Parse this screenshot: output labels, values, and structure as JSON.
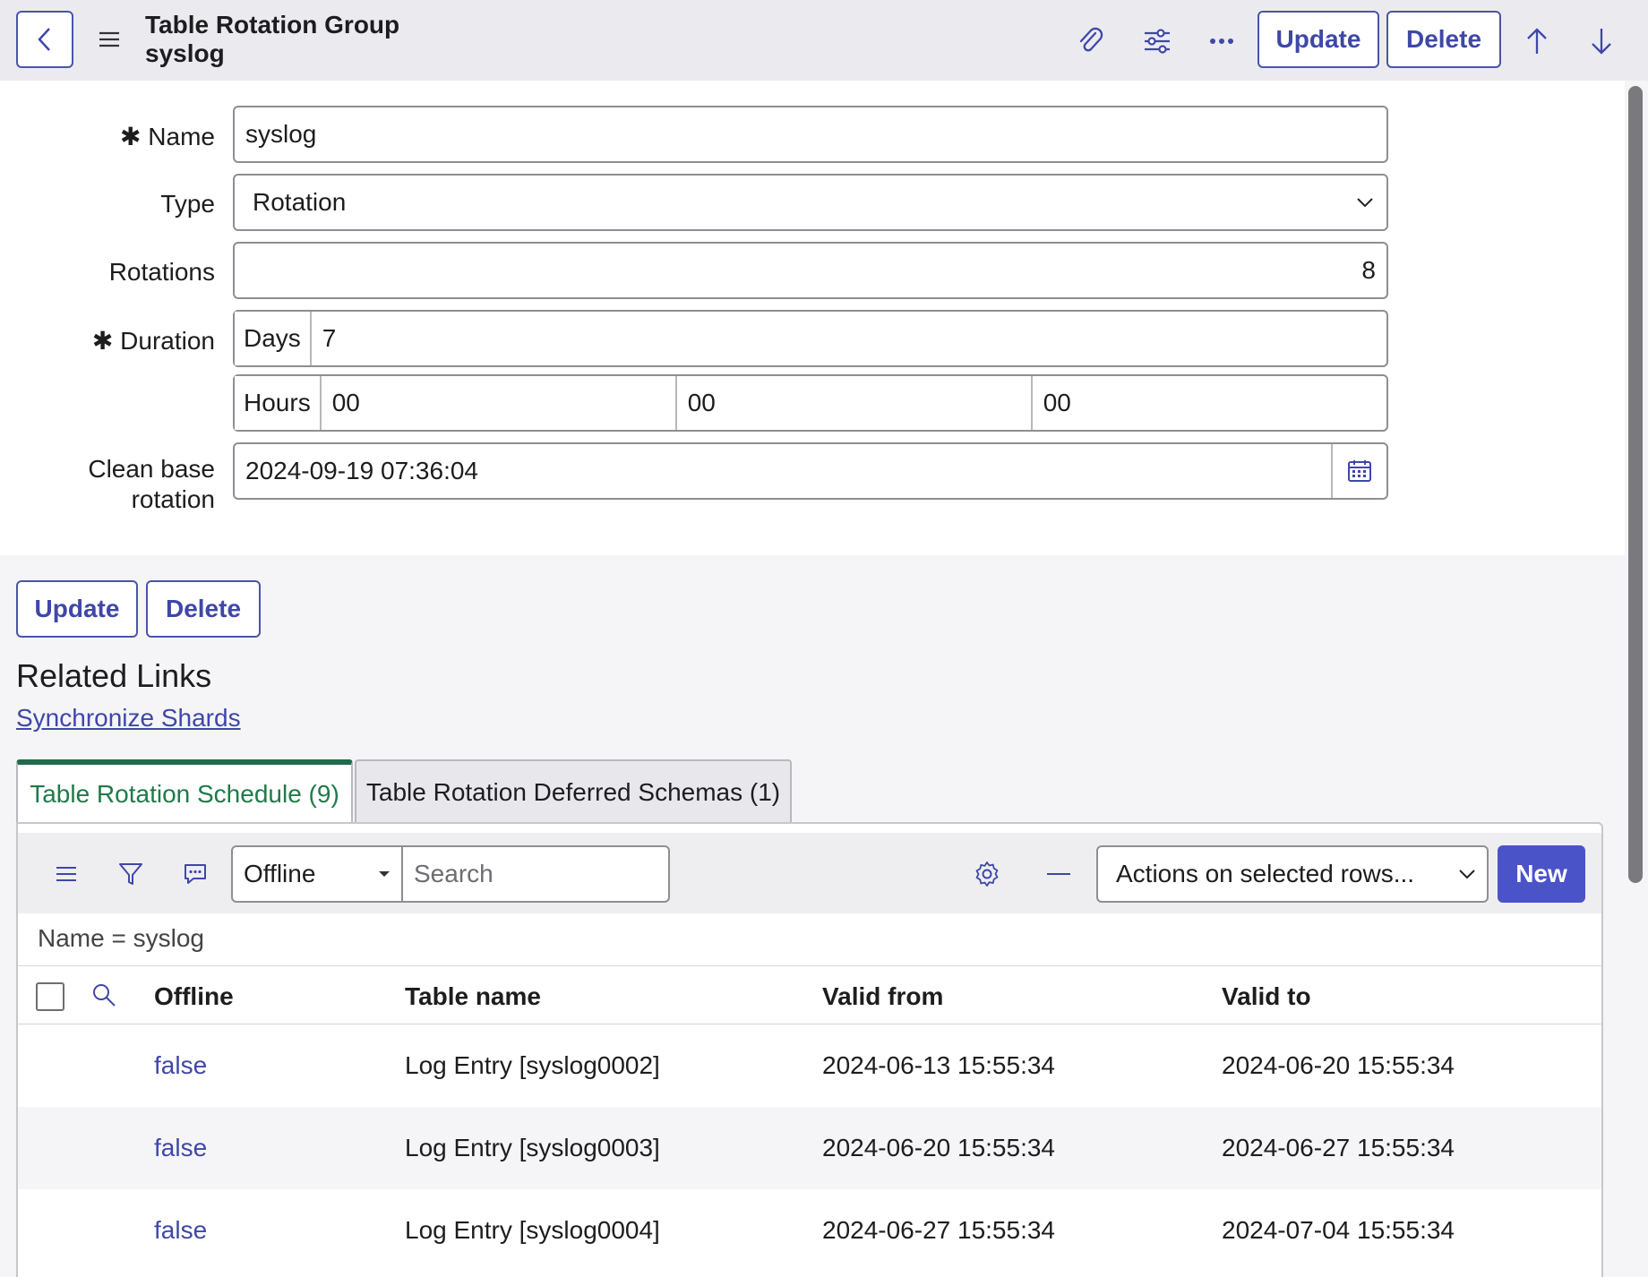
{
  "header": {
    "title_line1": "Table Rotation Group",
    "title_line2": "syslog",
    "update_label": "Update",
    "delete_label": "Delete"
  },
  "form": {
    "name_label": "Name",
    "name_value": "syslog",
    "type_label": "Type",
    "type_value": "Rotation",
    "rotations_label": "Rotations",
    "rotations_value": "8",
    "duration_label": "Duration",
    "days_prefix": "Days",
    "days_value": "7",
    "hours_prefix": "Hours",
    "hours_value": "00",
    "minutes_value": "00",
    "seconds_value": "00",
    "clean_label_line1": "Clean base",
    "clean_label_line2": "rotation",
    "clean_value": "2024-09-19 07:36:04",
    "required_mark": "✱"
  },
  "actions": {
    "update_label": "Update",
    "delete_label": "Delete"
  },
  "related": {
    "title": "Related Links",
    "link": "Synchronize Shards"
  },
  "tabs": [
    {
      "label": "Table Rotation Schedule (9)",
      "active": true
    },
    {
      "label": "Table Rotation Deferred Schemas (1)",
      "active": false
    }
  ],
  "list": {
    "filter_field": "Offline",
    "search_placeholder": "Search",
    "actions_select": "Actions on selected rows...",
    "new_label": "New",
    "breadcrumb": "Name = syslog",
    "columns": [
      "Offline",
      "Table name",
      "Valid from",
      "Valid to"
    ],
    "rows": [
      {
        "offline": "false",
        "table": "Log Entry [syslog0002]",
        "from": "2024-06-13 15:55:34",
        "to": "2024-06-20 15:55:34"
      },
      {
        "offline": "false",
        "table": "Log Entry [syslog0003]",
        "from": "2024-06-20 15:55:34",
        "to": "2024-06-27 15:55:34"
      },
      {
        "offline": "false",
        "table": "Log Entry [syslog0004]",
        "from": "2024-06-27 15:55:34",
        "to": "2024-07-04 15:55:34"
      }
    ]
  },
  "colors": {
    "accent": "#3f47a8",
    "primary_button": "#4b53c8",
    "active_tab": "#1f6b4a"
  }
}
